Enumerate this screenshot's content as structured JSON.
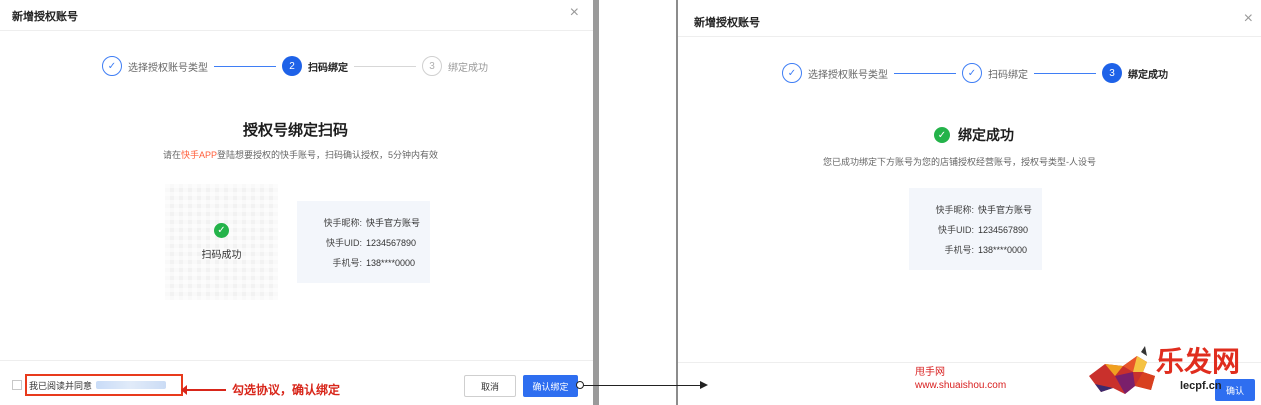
{
  "left_dialog": {
    "title": "新增授权账号",
    "close_label": "×",
    "steps": [
      {
        "number": "✓",
        "label": "选择授权账号类型",
        "state": "done"
      },
      {
        "number": "2",
        "label": "扫码绑定",
        "state": "active"
      },
      {
        "number": "3",
        "label": "绑定成功",
        "state": "todo"
      }
    ],
    "heading": "授权号绑定扫码",
    "instruction_prefix": "请在",
    "instruction_app": "快手APP",
    "instruction_suffix": "登陆想要授权的快手账号，扫码确认授权，5分钟内有效",
    "qr_status": "扫码成功",
    "info": [
      {
        "key": "快手昵称:",
        "value": "快手官方账号"
      },
      {
        "key": "快手UID:",
        "value": "1234567890"
      },
      {
        "key": "手机号:",
        "value": "138****0000"
      }
    ],
    "agreement_text": "我已阅读并同意",
    "annotation": "勾选协议，确认绑定",
    "cancel_label": "取消",
    "confirm_label": "确认绑定"
  },
  "right_dialog": {
    "title": "新增授权账号",
    "close_label": "×",
    "steps": [
      {
        "number": "✓",
        "label": "选择授权账号类型",
        "state": "done"
      },
      {
        "number": "✓",
        "label": "扫码绑定",
        "state": "done"
      },
      {
        "number": "3",
        "label": "绑定成功",
        "state": "active"
      }
    ],
    "success_heading": "绑定成功",
    "success_desc": "您已成功绑定下方账号为您的店铺授权经营账号，授权号类型-人设号",
    "info": [
      {
        "key": "快手昵称:",
        "value": "快手官方账号"
      },
      {
        "key": "快手UID:",
        "value": "1234567890"
      },
      {
        "key": "手机号:",
        "value": "138****0000"
      }
    ],
    "confirm_label": "确认"
  },
  "watermark": {
    "site_name": "甩手网",
    "site_url": "www.shuaishou.com",
    "brand": "乐发网",
    "brand_domain": "lecpf.cn"
  },
  "colors": {
    "primary": "#2e6ef0",
    "success": "#24b34a",
    "annotation": "#d8261a",
    "accent": "#ff5e3a"
  }
}
